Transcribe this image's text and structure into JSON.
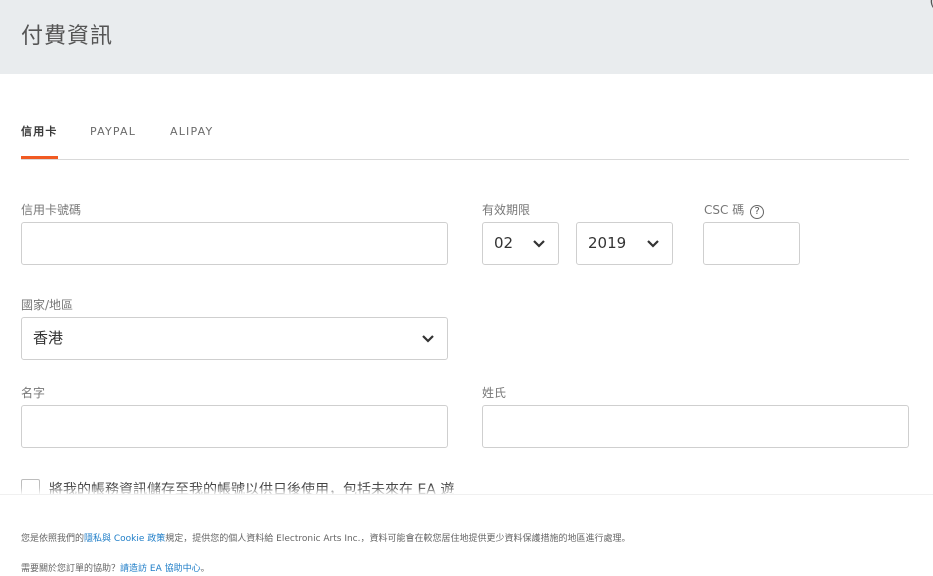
{
  "header": {
    "title": "付費資訊",
    "corner_glyph": "("
  },
  "tabs": [
    {
      "label": "信用卡",
      "active": true
    },
    {
      "label": "PAYPAL",
      "active": false
    },
    {
      "label": "ALIPAY",
      "active": false
    }
  ],
  "form": {
    "card_number_label": "信用卡號碼",
    "card_number_value": "",
    "expiry_label": "有效期限",
    "expiry_month": "02",
    "expiry_year": "2019",
    "csc_label": "CSC 碼",
    "csc_help": "?",
    "country_label": "國家/地區",
    "country_value": "香港",
    "first_name_label": "名字",
    "last_name_label": "姓氏",
    "save_checkbox_label": "將我的帳務資訊儲存至我的帳號以供日後使用，包括未來在 EA 遊"
  },
  "footer": {
    "privacy_prefix": "您是依照我們的",
    "privacy_link": "隱私與 Cookie 政策",
    "privacy_suffix": "規定，提供您的個人資料給 Electronic Arts Inc.，資料可能會在較您居住地提供更少資料保護措施的地區進行處理。",
    "help_prefix": "需要關於您訂單的協助？",
    "help_link": "請造訪 EA 協助中心",
    "help_suffix": "。"
  },
  "colors": {
    "accent": "#f15a22",
    "link": "#1f7ec8",
    "header_bg": "#e9ecee"
  }
}
